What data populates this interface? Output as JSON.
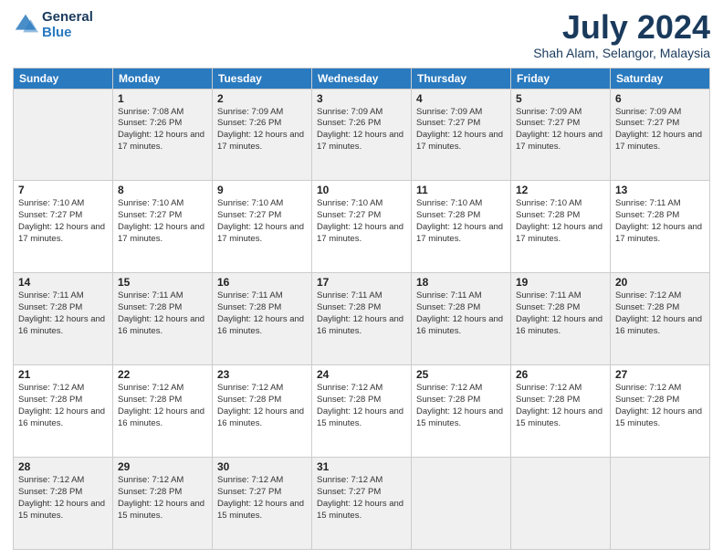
{
  "header": {
    "logo_line1": "General",
    "logo_line2": "Blue",
    "month": "July 2024",
    "location": "Shah Alam, Selangor, Malaysia"
  },
  "days_of_week": [
    "Sunday",
    "Monday",
    "Tuesday",
    "Wednesday",
    "Thursday",
    "Friday",
    "Saturday"
  ],
  "weeks": [
    [
      {
        "num": "",
        "sunrise": "",
        "sunset": "",
        "daylight": ""
      },
      {
        "num": "1",
        "sunrise": "Sunrise: 7:08 AM",
        "sunset": "Sunset: 7:26 PM",
        "daylight": "Daylight: 12 hours and 17 minutes."
      },
      {
        "num": "2",
        "sunrise": "Sunrise: 7:09 AM",
        "sunset": "Sunset: 7:26 PM",
        "daylight": "Daylight: 12 hours and 17 minutes."
      },
      {
        "num": "3",
        "sunrise": "Sunrise: 7:09 AM",
        "sunset": "Sunset: 7:26 PM",
        "daylight": "Daylight: 12 hours and 17 minutes."
      },
      {
        "num": "4",
        "sunrise": "Sunrise: 7:09 AM",
        "sunset": "Sunset: 7:27 PM",
        "daylight": "Daylight: 12 hours and 17 minutes."
      },
      {
        "num": "5",
        "sunrise": "Sunrise: 7:09 AM",
        "sunset": "Sunset: 7:27 PM",
        "daylight": "Daylight: 12 hours and 17 minutes."
      },
      {
        "num": "6",
        "sunrise": "Sunrise: 7:09 AM",
        "sunset": "Sunset: 7:27 PM",
        "daylight": "Daylight: 12 hours and 17 minutes."
      }
    ],
    [
      {
        "num": "7",
        "sunrise": "Sunrise: 7:10 AM",
        "sunset": "Sunset: 7:27 PM",
        "daylight": "Daylight: 12 hours and 17 minutes."
      },
      {
        "num": "8",
        "sunrise": "Sunrise: 7:10 AM",
        "sunset": "Sunset: 7:27 PM",
        "daylight": "Daylight: 12 hours and 17 minutes."
      },
      {
        "num": "9",
        "sunrise": "Sunrise: 7:10 AM",
        "sunset": "Sunset: 7:27 PM",
        "daylight": "Daylight: 12 hours and 17 minutes."
      },
      {
        "num": "10",
        "sunrise": "Sunrise: 7:10 AM",
        "sunset": "Sunset: 7:27 PM",
        "daylight": "Daylight: 12 hours and 17 minutes."
      },
      {
        "num": "11",
        "sunrise": "Sunrise: 7:10 AM",
        "sunset": "Sunset: 7:28 PM",
        "daylight": "Daylight: 12 hours and 17 minutes."
      },
      {
        "num": "12",
        "sunrise": "Sunrise: 7:10 AM",
        "sunset": "Sunset: 7:28 PM",
        "daylight": "Daylight: 12 hours and 17 minutes."
      },
      {
        "num": "13",
        "sunrise": "Sunrise: 7:11 AM",
        "sunset": "Sunset: 7:28 PM",
        "daylight": "Daylight: 12 hours and 17 minutes."
      }
    ],
    [
      {
        "num": "14",
        "sunrise": "Sunrise: 7:11 AM",
        "sunset": "Sunset: 7:28 PM",
        "daylight": "Daylight: 12 hours and 16 minutes."
      },
      {
        "num": "15",
        "sunrise": "Sunrise: 7:11 AM",
        "sunset": "Sunset: 7:28 PM",
        "daylight": "Daylight: 12 hours and 16 minutes."
      },
      {
        "num": "16",
        "sunrise": "Sunrise: 7:11 AM",
        "sunset": "Sunset: 7:28 PM",
        "daylight": "Daylight: 12 hours and 16 minutes."
      },
      {
        "num": "17",
        "sunrise": "Sunrise: 7:11 AM",
        "sunset": "Sunset: 7:28 PM",
        "daylight": "Daylight: 12 hours and 16 minutes."
      },
      {
        "num": "18",
        "sunrise": "Sunrise: 7:11 AM",
        "sunset": "Sunset: 7:28 PM",
        "daylight": "Daylight: 12 hours and 16 minutes."
      },
      {
        "num": "19",
        "sunrise": "Sunrise: 7:11 AM",
        "sunset": "Sunset: 7:28 PM",
        "daylight": "Daylight: 12 hours and 16 minutes."
      },
      {
        "num": "20",
        "sunrise": "Sunrise: 7:12 AM",
        "sunset": "Sunset: 7:28 PM",
        "daylight": "Daylight: 12 hours and 16 minutes."
      }
    ],
    [
      {
        "num": "21",
        "sunrise": "Sunrise: 7:12 AM",
        "sunset": "Sunset: 7:28 PM",
        "daylight": "Daylight: 12 hours and 16 minutes."
      },
      {
        "num": "22",
        "sunrise": "Sunrise: 7:12 AM",
        "sunset": "Sunset: 7:28 PM",
        "daylight": "Daylight: 12 hours and 16 minutes."
      },
      {
        "num": "23",
        "sunrise": "Sunrise: 7:12 AM",
        "sunset": "Sunset: 7:28 PM",
        "daylight": "Daylight: 12 hours and 16 minutes."
      },
      {
        "num": "24",
        "sunrise": "Sunrise: 7:12 AM",
        "sunset": "Sunset: 7:28 PM",
        "daylight": "Daylight: 12 hours and 15 minutes."
      },
      {
        "num": "25",
        "sunrise": "Sunrise: 7:12 AM",
        "sunset": "Sunset: 7:28 PM",
        "daylight": "Daylight: 12 hours and 15 minutes."
      },
      {
        "num": "26",
        "sunrise": "Sunrise: 7:12 AM",
        "sunset": "Sunset: 7:28 PM",
        "daylight": "Daylight: 12 hours and 15 minutes."
      },
      {
        "num": "27",
        "sunrise": "Sunrise: 7:12 AM",
        "sunset": "Sunset: 7:28 PM",
        "daylight": "Daylight: 12 hours and 15 minutes."
      }
    ],
    [
      {
        "num": "28",
        "sunrise": "Sunrise: 7:12 AM",
        "sunset": "Sunset: 7:28 PM",
        "daylight": "Daylight: 12 hours and 15 minutes."
      },
      {
        "num": "29",
        "sunrise": "Sunrise: 7:12 AM",
        "sunset": "Sunset: 7:28 PM",
        "daylight": "Daylight: 12 hours and 15 minutes."
      },
      {
        "num": "30",
        "sunrise": "Sunrise: 7:12 AM",
        "sunset": "Sunset: 7:27 PM",
        "daylight": "Daylight: 12 hours and 15 minutes."
      },
      {
        "num": "31",
        "sunrise": "Sunrise: 7:12 AM",
        "sunset": "Sunset: 7:27 PM",
        "daylight": "Daylight: 12 hours and 15 minutes."
      },
      {
        "num": "",
        "sunrise": "",
        "sunset": "",
        "daylight": ""
      },
      {
        "num": "",
        "sunrise": "",
        "sunset": "",
        "daylight": ""
      },
      {
        "num": "",
        "sunrise": "",
        "sunset": "",
        "daylight": ""
      }
    ]
  ]
}
